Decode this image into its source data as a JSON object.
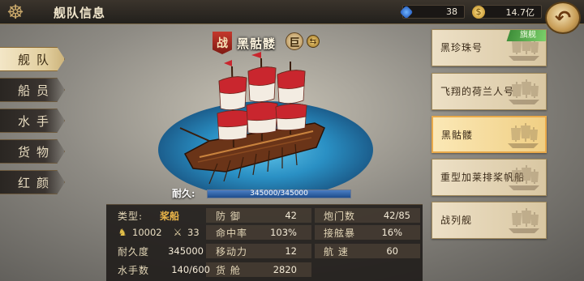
{
  "header": {
    "title": "舰队信息",
    "gems": "38",
    "gold": "14.7亿",
    "back_icon": "back-arrow-icon"
  },
  "nav": {
    "items": [
      {
        "label": "舰队",
        "active": true
      },
      {
        "label": "船员",
        "active": false
      },
      {
        "label": "水手",
        "active": false
      },
      {
        "label": "货物",
        "active": false
      },
      {
        "label": "红颜",
        "active": false
      }
    ]
  },
  "ship": {
    "role_tag": "战",
    "name": "黑骷髅",
    "size_badge": "巨",
    "durability_label": "耐久:",
    "durability_text": "345000/345000",
    "durability_fraction": 1.0
  },
  "stats": {
    "type_label": "类型:",
    "type_value": "桨船",
    "power": "10002",
    "attack": "33",
    "durability_k": "耐久度",
    "durability_v": "345000",
    "sailors_k": "水手数",
    "sailors_v": "140/600",
    "defense_k": "防 御",
    "defense_v": "42",
    "hit_k": "命中率",
    "hit_v": "103%",
    "move_k": "移动力",
    "move_v": "12",
    "cargo_k": "货 舱",
    "cargo_v": "2820",
    "cannon_k": "炮门数",
    "cannon_v": "42/85",
    "board_k": "接舷暴",
    "board_v": "16%",
    "speed_k": "航 速",
    "speed_v": "60"
  },
  "ship_list": {
    "flagship_tag": "旗舰",
    "items": [
      {
        "name": "黑珍珠号",
        "flagship": true,
        "active": false
      },
      {
        "name": "飞翔的荷兰人号",
        "flagship": false,
        "active": false
      },
      {
        "name": "黑骷髅",
        "flagship": false,
        "active": true
      },
      {
        "name": "重型加莱排桨帆船",
        "flagship": false,
        "active": false
      },
      {
        "name": "战列舰",
        "flagship": false,
        "active": false
      }
    ]
  }
}
